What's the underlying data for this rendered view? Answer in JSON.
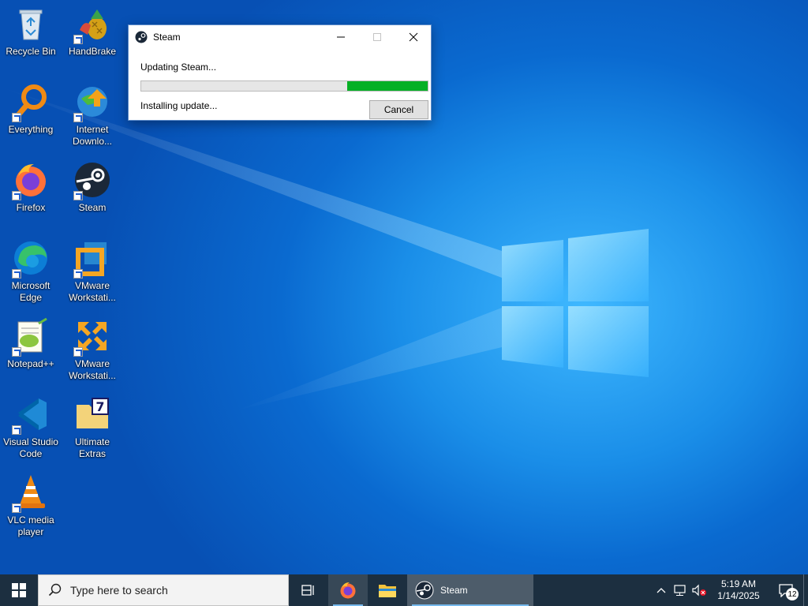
{
  "desktop": {
    "icons": [
      {
        "label": "Recycle Bin",
        "icon": "recycle-bin-icon"
      },
      {
        "label": "HandBrake",
        "icon": "handbrake-icon"
      },
      {
        "label": "Everything",
        "icon": "everything-search-icon"
      },
      {
        "label": "Internet Downlo...",
        "icon": "internet-download-manager-icon"
      },
      {
        "label": "Firefox",
        "icon": "firefox-icon"
      },
      {
        "label": "Steam",
        "icon": "steam-icon"
      },
      {
        "label": "Microsoft Edge",
        "icon": "edge-icon"
      },
      {
        "label": "VMware Workstati...",
        "icon": "vmware-icon"
      },
      {
        "label": "Notepad++",
        "icon": "notepadpp-icon"
      },
      {
        "label": "VMware Workstati...",
        "icon": "vmware-player-icon"
      },
      {
        "label": "Visual Studio Code",
        "icon": "vscode-icon"
      },
      {
        "label": "Ultimate Extras",
        "icon": "folder-7-icon"
      },
      {
        "label": "VLC media player",
        "icon": "vlc-icon"
      }
    ]
  },
  "dialog": {
    "title": "Steam",
    "status": "Updating Steam...",
    "progress_fraction": 0.28,
    "progress_color": "#06b025",
    "substatus": "Installing update...",
    "cancel_label": "Cancel"
  },
  "taskbar": {
    "search_placeholder": "Type here to search",
    "apps": [
      {
        "name": "task-view",
        "icon": "task-view-icon"
      },
      {
        "name": "firefox",
        "icon": "firefox-icon"
      },
      {
        "name": "file-explorer",
        "icon": "folder-icon"
      }
    ],
    "steam_label": "Steam",
    "clock_time": "5:19 AM",
    "clock_date": "1/14/2025",
    "notification_count": "12",
    "color": "#1c2f40"
  }
}
